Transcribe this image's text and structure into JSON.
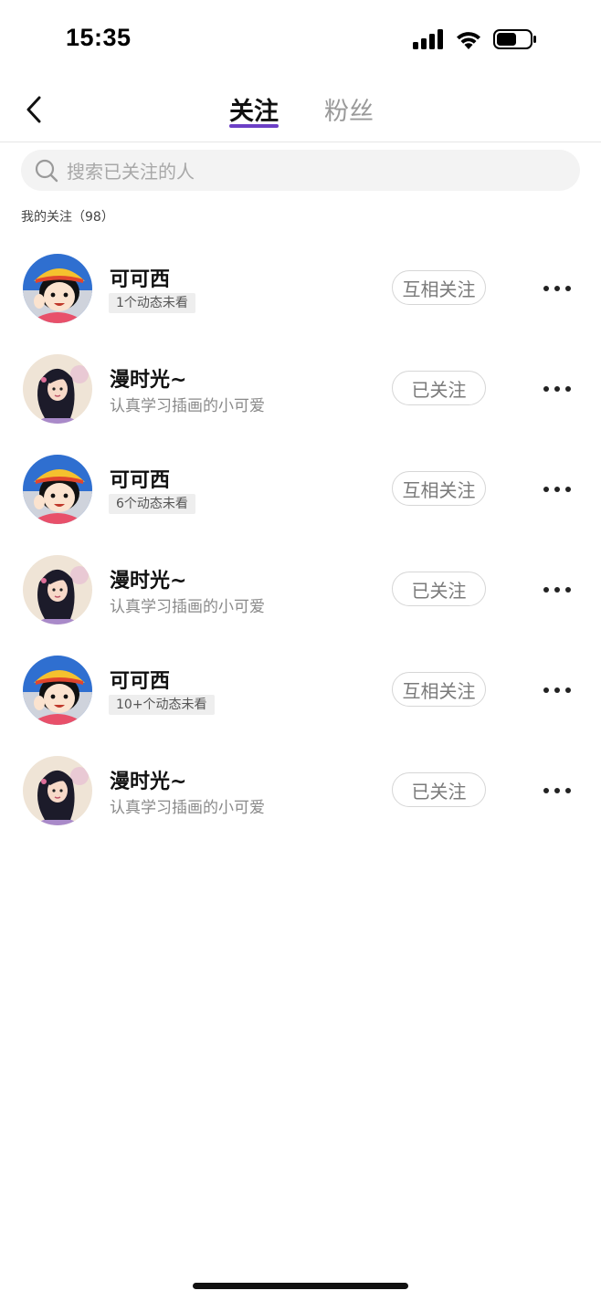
{
  "status": {
    "time": "15:35",
    "icons": [
      "cellular-signal-icon",
      "wifi-icon",
      "battery-icon"
    ],
    "battery_level": 0.6
  },
  "nav": {
    "back_icon": "chevron-left-icon",
    "tabs": [
      {
        "label": "关注",
        "active": true
      },
      {
        "label": "粉丝",
        "active": false
      }
    ],
    "accent_color": "#6c3fc6"
  },
  "search": {
    "icon": "search-icon",
    "placeholder": "搜索已关注的人"
  },
  "section_title": "我的关注（98）",
  "follows": [
    {
      "name": "可可西",
      "avatar": "boy-yellow-hat-avatar",
      "tag": "1个动态未看",
      "bio": "",
      "button": "互相关注"
    },
    {
      "name": "漫时光~",
      "avatar": "girl-long-hair-avatar",
      "tag": "",
      "bio": "认真学习插画的小可爱",
      "button": "已关注"
    },
    {
      "name": "可可西",
      "avatar": "boy-yellow-hat-avatar",
      "tag": "6个动态未看",
      "bio": "",
      "button": "互相关注"
    },
    {
      "name": "漫时光~",
      "avatar": "girl-long-hair-avatar",
      "tag": "",
      "bio": "认真学习插画的小可爱",
      "button": "已关注"
    },
    {
      "name": "可可西",
      "avatar": "boy-yellow-hat-avatar",
      "tag": "10+个动态未看",
      "bio": "",
      "button": "互相关注"
    },
    {
      "name": "漫时光~",
      "avatar": "girl-long-hair-avatar",
      "tag": "",
      "bio": "认真学习插画的小可爱",
      "button": "已关注"
    }
  ],
  "more_icon": "more-horizontal-icon"
}
